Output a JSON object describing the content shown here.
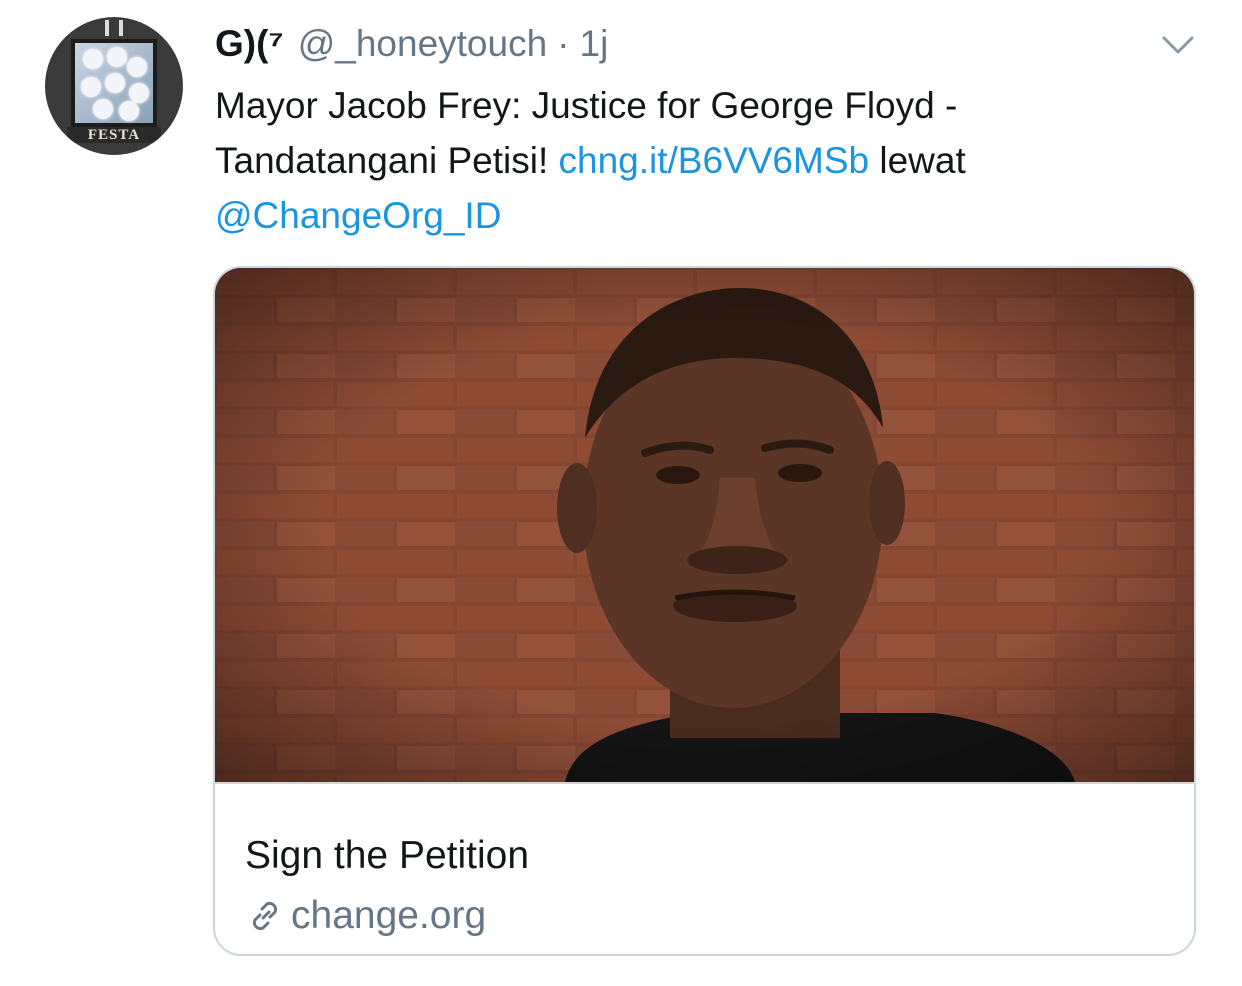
{
  "tweet": {
    "author": {
      "display_name": "G)(⁷",
      "handle": "@_honeytouch",
      "avatar_banner": "FESTA"
    },
    "separator": "·",
    "timestamp": "1j",
    "text": {
      "part1": "Mayor Jacob Frey: Justice for George Floyd - Tandatangani Petisi! ",
      "link": "chng.it/B6VV6MSb",
      "part2": " lewat ",
      "mention": "@ChangeOrg_ID"
    },
    "card": {
      "title": "Sign the Petition",
      "domain": "change.org"
    }
  },
  "icons": {
    "menu": "chevron-down-icon",
    "link": "link-icon"
  },
  "colors": {
    "text_primary": "#14171a",
    "text_secondary": "#657786",
    "link": "#1b95e0",
    "border": "#ccd6dd"
  }
}
